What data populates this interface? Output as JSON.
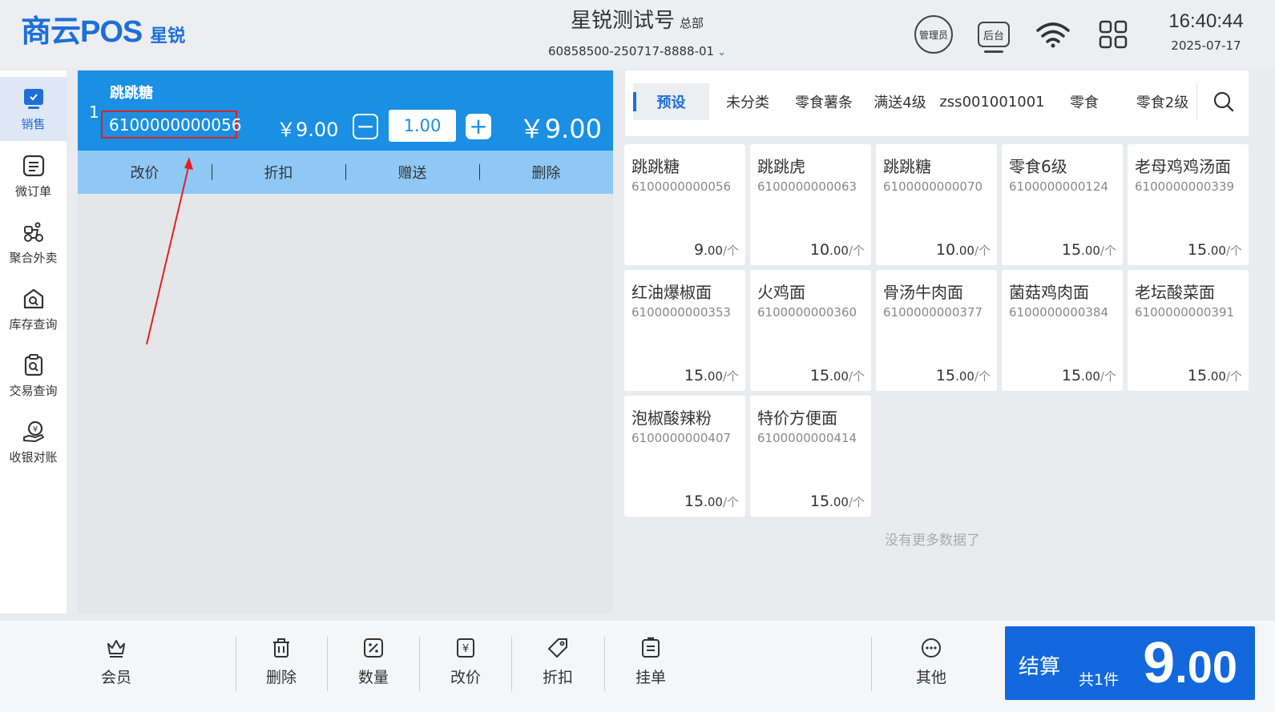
{
  "header": {
    "logo_main": "商云POS",
    "logo_sub": "星锐",
    "store_name": "星锐测试号",
    "store_tag": "总部",
    "store_id": "60858500-250717-8888-01",
    "admin_label": "管理员",
    "backend_label": "后台",
    "time": "16:40:44",
    "date": "2025-07-17"
  },
  "nav": {
    "items": [
      {
        "label": "销售",
        "icon": "sales-icon"
      },
      {
        "label": "微订单",
        "icon": "micro-order-icon"
      },
      {
        "label": "聚合外卖",
        "icon": "delivery-icon"
      },
      {
        "label": "库存查询",
        "icon": "inventory-search-icon"
      },
      {
        "label": "交易查询",
        "icon": "transaction-search-icon"
      },
      {
        "label": "收银对账",
        "icon": "reconciliation-icon"
      }
    ]
  },
  "cart": {
    "item": {
      "index": "1",
      "name": "跳跳糖",
      "code": "6100000000056",
      "price": "￥9.00",
      "minus": "−",
      "qty": "1.00",
      "plus": "+",
      "total": "￥9.00"
    },
    "actions": [
      "改价",
      "折扣",
      "赠送",
      "删除"
    ]
  },
  "categories": [
    "预设",
    "未分类",
    "零食薯条",
    "满送4级",
    "zss001001001",
    "零食",
    "零食2级"
  ],
  "products": [
    {
      "name": "跳跳糖",
      "code": "6100000000056",
      "price_int": "9",
      "price_dec": ".00",
      "unit": "/个"
    },
    {
      "name": "跳跳虎",
      "code": "6100000000063",
      "price_int": "10",
      "price_dec": ".00",
      "unit": "/个"
    },
    {
      "name": "跳跳糖",
      "code": "6100000000070",
      "price_int": "10",
      "price_dec": ".00",
      "unit": "/个"
    },
    {
      "name": "零食6级",
      "code": "6100000000124",
      "price_int": "15",
      "price_dec": ".00",
      "unit": "/个"
    },
    {
      "name": "老母鸡鸡汤面",
      "code": "6100000000339",
      "price_int": "15",
      "price_dec": ".00",
      "unit": "/个"
    },
    {
      "name": "红油爆椒面",
      "code": "6100000000353",
      "price_int": "15",
      "price_dec": ".00",
      "unit": "/个"
    },
    {
      "name": "火鸡面",
      "code": "6100000000360",
      "price_int": "15",
      "price_dec": ".00",
      "unit": "/个"
    },
    {
      "name": "骨汤牛肉面",
      "code": "6100000000377",
      "price_int": "15",
      "price_dec": ".00",
      "unit": "/个"
    },
    {
      "name": "菌菇鸡肉面",
      "code": "6100000000384",
      "price_int": "15",
      "price_dec": ".00",
      "unit": "/个"
    },
    {
      "name": "老坛酸菜面",
      "code": "6100000000391",
      "price_int": "15",
      "price_dec": ".00",
      "unit": "/个"
    },
    {
      "name": "泡椒酸辣粉",
      "code": "6100000000407",
      "price_int": "15",
      "price_dec": ".00",
      "unit": "/个"
    },
    {
      "name": "特价方便面",
      "code": "6100000000414",
      "price_int": "15",
      "price_dec": ".00",
      "unit": "/个"
    }
  ],
  "no_more": "没有更多数据了",
  "bottom": {
    "member": "会员",
    "delete": "删除",
    "quantity": "数量",
    "change_price": "改价",
    "discount": "折扣",
    "hold": "挂单",
    "other": "其他"
  },
  "checkout": {
    "label": "结算",
    "count": "共1件",
    "amount_int": "9",
    "amount_dec": ".00"
  },
  "colors": {
    "accent": "#1e6fd8",
    "cart_row": "#1a8fe3",
    "cart_actions": "#8fc8f5",
    "checkout": "#1368dd",
    "annotation": "#e32020"
  }
}
